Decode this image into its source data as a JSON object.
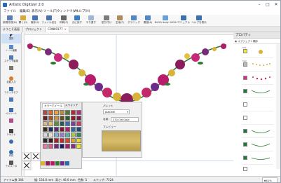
{
  "window": {
    "title": "Artistic Digitizer 2.0",
    "minimize": "–",
    "maximize": "□",
    "close": "✕"
  },
  "menu": [
    "ファイル",
    "編集(E)",
    "表示(V)",
    "ツール(T)",
    "ウィンドウ(W)",
    "ヘルプ(H)"
  ],
  "toolbar": [
    {
      "label": "新規作成(N)",
      "color": "#5b7fb5"
    },
    {
      "label": "開く(O)",
      "color": "#d9a93a"
    },
    {
      "label": "保存(S)",
      "color": "#4a72b0"
    },
    {
      "label": "ファイル名を",
      "color": "#4a72b0"
    },
    {
      "label": "印刷(P)",
      "color": "#666666"
    },
    {
      "label": "元に戻す",
      "color": "#3c7ac2"
    },
    {
      "label": "やり直す",
      "color": "#9fb7d4"
    },
    {
      "label": "貼り付け",
      "color": "#7b7b7b"
    },
    {
      "label": "生地(F)",
      "color": "#b08a5a"
    },
    {
      "label": "グラニック",
      "color": "#4f88c4"
    },
    {
      "label": "素描(A)",
      "color": "#4f88c4"
    },
    {
      "label": "BLOG daily 1000+",
      "color": "#6aa0d8"
    },
    {
      "label": "マニュアル",
      "color": "#3a6fb0"
    },
    {
      "label": "ヘルプを表示",
      "color": "#3a6fb0"
    }
  ],
  "tabs": [
    {
      "label": "ようこそ画面",
      "closable": false
    },
    {
      "label": "プロジェクト",
      "closable": true
    },
    {
      "label": "CON00177",
      "closable": true
    }
  ],
  "left_tools": [
    "選択",
    "ノード編集",
    "ステッチ編集",
    "",
    "自動入力",
    "ステッチモア",
    "",
    "ペンツール",
    "",
    "テキスト",
    "",
    "円形",
    "テキストの",
    "",
    "",
    "",
    "",
    "",
    "",
    "描画モード"
  ],
  "properties_panel": {
    "header": "プロパティ",
    "object_list_label": "オブジェクト順序"
  },
  "object_rows": [
    {
      "num": "501",
      "color": "#f7e92b"
    },
    {
      "num": "502",
      "color": "#b8b8b8"
    },
    {
      "num": "",
      "color": "#e22a8a"
    },
    {
      "num": "",
      "color": "#1d7a3a"
    },
    {
      "num": "",
      "color": "#ffffff"
    },
    {
      "num": "",
      "color": "#ffffff"
    },
    {
      "num": "",
      "color": "#1d7a3a"
    },
    {
      "num": "",
      "color": "#1d7a3a"
    },
    {
      "num": "",
      "color": "#1d7a3a"
    },
    {
      "num": "",
      "color": "#ffffff"
    }
  ],
  "color_palette": {
    "tab_active": "カラーホイール",
    "tab_other": "スウォッチ",
    "swatches": [
      "#b6464d",
      "#d86b2b",
      "#e7a53a",
      "#b98b3a",
      "#4c7a35",
      "#b82a31",
      "#b42c7a",
      "#6d1d23",
      "#a05427",
      "#c8973b",
      "#6b4a24",
      "#2f5c2c",
      "#8c1d24",
      "#7a1b4f",
      "#d8b98a",
      "#e6c36a",
      "#5c8e3c",
      "#1e5e56",
      "#3b6bb2",
      "#7a3f9c",
      "#c43c66",
      "#3c2c1c",
      "#1b2f5c",
      "#5a2a7a",
      "#7b1b33",
      "#b01c6a",
      "#2c6aa8",
      "#1c4a7a",
      "#d8d8d8",
      "#e8e2cc",
      "#7ab0d8",
      "#9c7ac8",
      "#5ab2a2",
      "#a8c84e",
      "#2e8b57",
      "#2b2b2b",
      "#3a1d1d",
      "#a81c2c",
      "#c2282c",
      "#d24a28",
      "#d8a52c",
      "#e8d82c",
      "#e87aa8",
      "#d85a8e",
      "#6c2a7a",
      "#1c1c6c",
      "#b01c6a",
      "#8a2a8a",
      "#f2e21c"
    ]
  },
  "thread_properties": {
    "palette_label": "パレット",
    "palette_value": "JANOME",
    "name_label": "名前:",
    "name_value": "270 Old Gold",
    "preview_label": "プレビュー"
  },
  "status_bar": {
    "items": "アイテム数 346",
    "width": "幅: 136.8 mm",
    "height": "高さ: 46.6 mm",
    "colors": "色数: 5",
    "stitches": "ステッチ: 7524",
    "zoom": "161%"
  }
}
